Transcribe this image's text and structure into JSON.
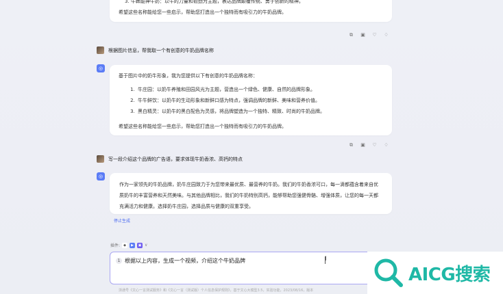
{
  "messages": {
    "prev_card": {
      "line3": "3. 牛犇能神牛奶：以牛的力量和韧劲为主题，表达品牌颠覆传统、勇于创新的精神。",
      "closing": "希望这些名称能给您一些启示，帮助您打造出一个独特而有吸引力的牛奶品牌。"
    },
    "user1": "根据图片信息，帮我取一个有创意的牛奶品牌名称",
    "bot1": {
      "intro": "基于图片中的奶牛形象，我为您提供以下有创意的牛奶品牌名称：",
      "items": [
        "牛庄园：以奶牛养殖和田园风光为主题，营造出一个绿色、健康、自然的品牌形象。",
        "牛牛鲜饮：以奶牛的生动形象和新鲜口感为特点，强调品牌的新鲜、美味和营养价值。",
        "黑白精灵：以奶牛的黑白配色为灵感，将品牌塑造为一个独特、精致、时尚的牛奶品牌。"
      ],
      "closing": "希望这些名称能给您一些启示，帮助您打造出一个独特而有吸引力的牛奶品牌。"
    },
    "user2": "写一段介绍这个品牌的广告语，要求体现牛奶香浓、高钙的特点",
    "bot2": {
      "text": "作为一家领先的牛奶品牌，奶牛庄园致力于为您带来最优质、最营养的牛奶。我们的牛奶香浓可口，每一滴都蕴含着来自优质奶牛的丰富营养和天然美味。与其他品牌相比，我们的牛奶特别高钙，能够帮助您强健骨骼、增强体质，让您的每一天都充满活力和健康。选择奶牛庄园，选择品质与健康的双重享受。"
    },
    "stop_label": "停止生成"
  },
  "composer": {
    "ops_label": "插件:",
    "input_value": "根据以上内容，生成一个视频，介绍这个牛奶品牌"
  },
  "footer": "浙通号《文心一言测试服务》和《文心一言（测试版）个人信息保护规则》，基于文心大模型3.5，实验功能，2023/08/16，版本",
  "watermark": {
    "text": "AICG搜索"
  },
  "colors": {
    "accent": "#5b7cf6",
    "brand": "#1fb8a6",
    "input_border": "#a9a6f2"
  }
}
